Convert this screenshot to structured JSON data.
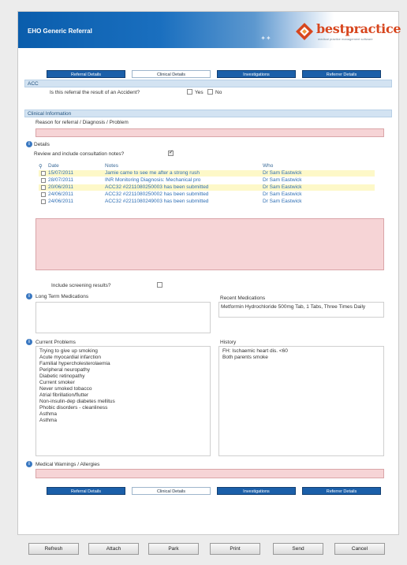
{
  "header": {
    "title": "EHO Generic Referral",
    "brand": "bestpractice",
    "brand_sub": "medical practice management software"
  },
  "tabs": [
    "Referral Details",
    "Clinical Details",
    "Investigations",
    "Referrer Details"
  ],
  "acc": {
    "section": "ACC",
    "question": "Is this referral the result of an Accident?",
    "yes_label": "Yes",
    "no_label": "No"
  },
  "clinical": {
    "section": "Clinical Information",
    "reason_label": "Reason for referral / Diagnosis / Problem",
    "details_label": "Details",
    "review_label": "Review and include consultation notes?",
    "notes_headers": {
      "date": "Date",
      "notes": "Notes",
      "who": "Who"
    },
    "notes": [
      {
        "date": "15/07/2011",
        "note": "Jamie came to see me after a strong rush",
        "who": "Dr Sam Eastwick",
        "highlight": true
      },
      {
        "date": "28/07/2011",
        "note": "INR Monitoring Diagnosis: Mechanical pro",
        "who": "Dr Sam Eastwick",
        "highlight": false
      },
      {
        "date": "20/06/2011",
        "note": "ACC32 #2211080250003 has been submitted",
        "who": "Dr Sam Eastwick",
        "highlight": true
      },
      {
        "date": "24/06/2011",
        "note": "ACC32 #2211080250002 has been submitted",
        "who": "Dr Sam Eastwick",
        "highlight": false
      },
      {
        "date": "24/06/2011",
        "note": "ACC32 #2211080249003 has been submitted",
        "who": "Dr Sam Eastwick",
        "highlight": false
      }
    ],
    "screening_label": "Include screening results?"
  },
  "medications": {
    "long_term_label": "Long Term Medications",
    "recent_label": "Recent Medications",
    "recent_value": "Metformin Hydrochloride 500mg Tab, 1 Tabs, Three Times Daily"
  },
  "problems": {
    "current_label": "Current Problems",
    "items": [
      "Trying to give up smoking",
      "Acute myocardial infarction",
      "Familial hypercholesterolaemia",
      "Peripheral neuropathy",
      "Diabetic retinopathy",
      "Current smoker",
      "Never smoked tobacco",
      "Atrial fibrillation/flutter",
      "Non-insulin-dep diabetes mellitus",
      "Phobic disorders - cleanliness",
      "Asthma",
      "Asthma"
    ],
    "history_label": "History",
    "history_lines": [
      "FH: Ischaemic heart dis. <60",
      "Both parents smoke"
    ]
  },
  "warnings": {
    "label": "Medical Warnings / Allergies"
  },
  "buttons": [
    "Refresh",
    "Attach",
    "Park",
    "Print",
    "Send",
    "Cancel"
  ],
  "colors": {
    "header_blue": "#0a5dac",
    "tab_blue": "#1b5fa9",
    "required_field": "#f6d4d6",
    "note_highlight": "#fdf8c8",
    "brand_orange": "#d7461e"
  }
}
